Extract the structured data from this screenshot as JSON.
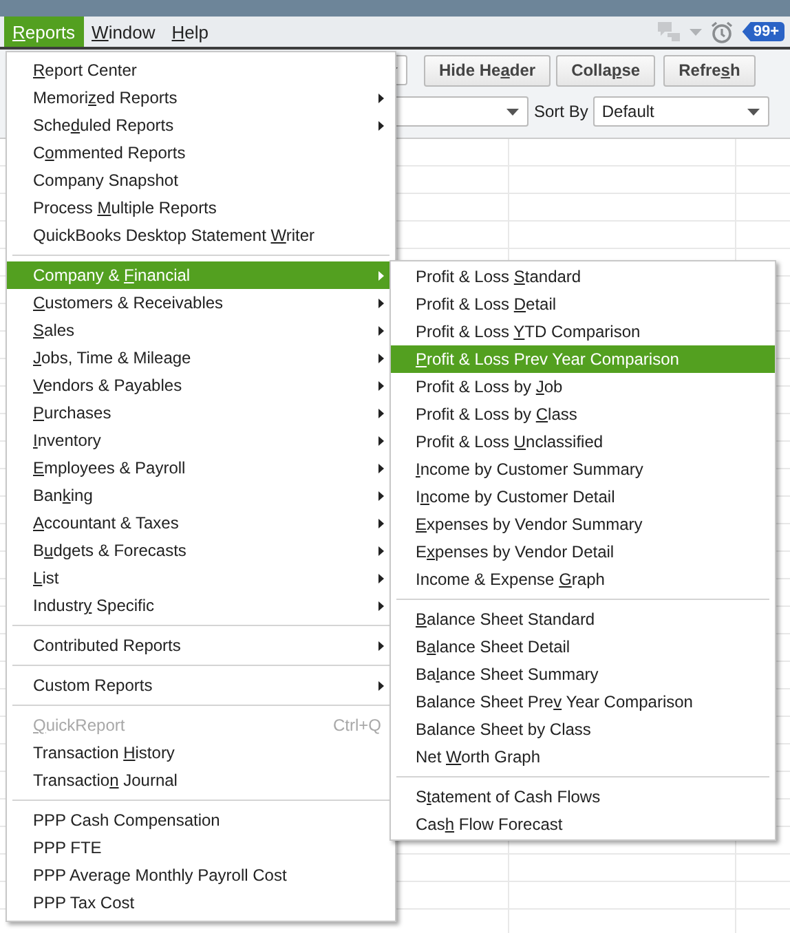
{
  "menu_bar": {
    "items": [
      {
        "key": "R",
        "text_after": "eports",
        "selected": true
      },
      {
        "key": "W",
        "text_after": "indow",
        "selected": false
      },
      {
        "key": "H",
        "text_after": "elp",
        "selected": false
      }
    ],
    "notification_badge": "99+"
  },
  "report_toolbar": {
    "buttons": [
      {
        "text_before": "Hide He",
        "key": "a",
        "text_after": "der"
      },
      {
        "text_before": "Colla",
        "key": "p",
        "text_after": "se"
      },
      {
        "text_before": "Refre",
        "key": "s",
        "text_after": "h"
      }
    ],
    "sort_by_label": "Sort By",
    "sort_by_value": "Default"
  },
  "reports_menu": {
    "groups": [
      [
        {
          "key": "R",
          "text_after": "eport Center",
          "submenu": false,
          "selected": false,
          "disabled": false
        },
        {
          "text_before": "Memori",
          "key": "z",
          "text_after": "ed Reports",
          "submenu": true,
          "selected": false,
          "disabled": false
        },
        {
          "text_before": "Sche",
          "key": "d",
          "text_after": "uled Reports",
          "submenu": true,
          "selected": false,
          "disabled": false
        },
        {
          "text_before": "C",
          "key": "o",
          "text_after": "mmented Reports",
          "submenu": false,
          "selected": false,
          "disabled": false
        },
        {
          "text_before": "Company Snapshot",
          "submenu": false,
          "selected": false,
          "disabled": false
        },
        {
          "text_before": "Process ",
          "key": "M",
          "text_after": "ultiple Reports",
          "submenu": false,
          "selected": false,
          "disabled": false
        },
        {
          "text_before": "QuickBooks Desktop Statement ",
          "key": "W",
          "text_after": "riter",
          "submenu": false,
          "selected": false,
          "disabled": false
        }
      ],
      [
        {
          "text_before": "Company & ",
          "key": "F",
          "text_after": "inancial",
          "submenu": true,
          "selected": true,
          "disabled": false
        },
        {
          "key": "C",
          "text_after": "ustomers & Receivables",
          "submenu": true,
          "selected": false,
          "disabled": false
        },
        {
          "key": "S",
          "text_after": "ales",
          "submenu": true,
          "selected": false,
          "disabled": false
        },
        {
          "key": "J",
          "text_after": "obs, Time & Mileage",
          "submenu": true,
          "selected": false,
          "disabled": false
        },
        {
          "key": "V",
          "text_after": "endors & Payables",
          "submenu": true,
          "selected": false,
          "disabled": false
        },
        {
          "key": "P",
          "text_after": "urchases",
          "submenu": true,
          "selected": false,
          "disabled": false
        },
        {
          "key": "I",
          "text_after": "nventory",
          "submenu": true,
          "selected": false,
          "disabled": false
        },
        {
          "key": "E",
          "text_after": "mployees & Payroll",
          "submenu": true,
          "selected": false,
          "disabled": false
        },
        {
          "text_before": "Ban",
          "key": "k",
          "text_after": "ing",
          "submenu": true,
          "selected": false,
          "disabled": false
        },
        {
          "key": "A",
          "text_after": "ccountant & Taxes",
          "submenu": true,
          "selected": false,
          "disabled": false
        },
        {
          "text_before": "B",
          "key": "u",
          "text_after": "dgets & Forecasts",
          "submenu": true,
          "selected": false,
          "disabled": false
        },
        {
          "key": "L",
          "text_after": "ist",
          "submenu": true,
          "selected": false,
          "disabled": false
        },
        {
          "text_before": "Industr",
          "key": "y",
          "text_after": " Specific",
          "submenu": true,
          "selected": false,
          "disabled": false
        }
      ],
      [
        {
          "text_before": "Contributed Reports",
          "submenu": true,
          "selected": false,
          "disabled": false
        }
      ],
      [
        {
          "text_before": "Custom Reports",
          "submenu": true,
          "selected": false,
          "disabled": false
        }
      ],
      [
        {
          "key": "Q",
          "text_after": "uickReport",
          "shortcut": "Ctrl+Q",
          "submenu": false,
          "selected": false,
          "disabled": true
        },
        {
          "text_before": "Transaction ",
          "key": "H",
          "text_after": "istory",
          "submenu": false,
          "selected": false,
          "disabled": false
        },
        {
          "text_before": "Transactio",
          "key": "n",
          "text_after": " Journal",
          "submenu": false,
          "selected": false,
          "disabled": false
        }
      ],
      [
        {
          "text_before": "PPP Cash Compensation",
          "submenu": false,
          "selected": false,
          "disabled": false
        },
        {
          "text_before": "PPP FTE",
          "submenu": false,
          "selected": false,
          "disabled": false
        },
        {
          "text_before": "PPP Average Monthly Payroll Cost",
          "submenu": false,
          "selected": false,
          "disabled": false
        },
        {
          "text_before": "PPP Tax Cost",
          "submenu": false,
          "selected": false,
          "disabled": false
        }
      ]
    ]
  },
  "company_financial_submenu": {
    "groups": [
      [
        {
          "text_before": "Profit & Loss ",
          "key": "S",
          "text_after": "tandard",
          "selected": false
        },
        {
          "text_before": "Profit & Loss ",
          "key": "D",
          "text_after": "etail",
          "selected": false
        },
        {
          "text_before": "Profit & Loss ",
          "key": "Y",
          "text_after": "TD Comparison",
          "selected": false
        },
        {
          "key": "P",
          "text_after": "rofit & Loss Prev Year Comparison",
          "selected": true
        },
        {
          "text_before": "Profit & Loss by ",
          "key": "J",
          "text_after": "ob",
          "selected": false
        },
        {
          "text_before": "Profit & Loss by ",
          "key": "C",
          "text_after": "lass",
          "selected": false
        },
        {
          "text_before": "Profit & Loss ",
          "key": "U",
          "text_after": "nclassified",
          "selected": false
        },
        {
          "key": "I",
          "text_after": "ncome by Customer Summary",
          "selected": false
        },
        {
          "text_before": "I",
          "key": "n",
          "text_after": "come by Customer Detail",
          "selected": false
        },
        {
          "key": "E",
          "text_after": "xpenses by Vendor Summary",
          "selected": false
        },
        {
          "text_before": "E",
          "key": "x",
          "text_after": "penses by Vendor Detail",
          "selected": false
        },
        {
          "text_before": "Income & Expense ",
          "key": "G",
          "text_after": "raph",
          "selected": false
        }
      ],
      [
        {
          "key": "B",
          "text_after": "alance Sheet Standard",
          "selected": false
        },
        {
          "text_before": "B",
          "key": "a",
          "text_after": "lance Sheet Detail",
          "selected": false
        },
        {
          "text_before": "Ba",
          "key": "l",
          "text_after": "ance Sheet Summary",
          "selected": false
        },
        {
          "text_before": "Balance Sheet Pre",
          "key": "v",
          "text_after": " Year Comparison",
          "selected": false
        },
        {
          "text_before": "Balance Sheet by Class",
          "selected": false
        },
        {
          "text_before": "Net ",
          "key": "W",
          "text_after": "orth Graph",
          "selected": false
        }
      ],
      [
        {
          "text_before": "S",
          "key": "t",
          "text_after": "atement of Cash Flows",
          "selected": false
        },
        {
          "text_before": "Cas",
          "key": "h",
          "text_after": " Flow Forecast",
          "selected": false
        }
      ]
    ]
  }
}
